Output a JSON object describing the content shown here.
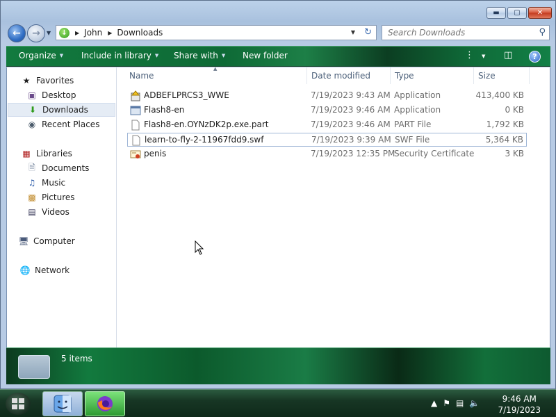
{
  "window": {
    "controls": {
      "minimize": "▬",
      "maximize": "▢",
      "close": "✕"
    }
  },
  "address": {
    "crumbs": [
      "John",
      "Downloads"
    ],
    "search_placeholder": "Search Downloads"
  },
  "toolbar": {
    "organize": "Organize",
    "include_in_library": "Include in library",
    "share_with": "Share with",
    "new_folder": "New folder",
    "help": "?"
  },
  "sidebar": {
    "favorites": {
      "label": "Favorites",
      "items": [
        {
          "label": "Desktop",
          "icon": "desktop-icon"
        },
        {
          "label": "Downloads",
          "icon": "downloads-icon",
          "selected": true
        },
        {
          "label": "Recent Places",
          "icon": "recent-places-icon"
        }
      ]
    },
    "libraries": {
      "label": "Libraries",
      "items": [
        {
          "label": "Documents",
          "icon": "documents-icon"
        },
        {
          "label": "Music",
          "icon": "music-icon"
        },
        {
          "label": "Pictures",
          "icon": "pictures-icon"
        },
        {
          "label": "Videos",
          "icon": "videos-icon"
        }
      ]
    },
    "computer": "Computer",
    "network": "Network"
  },
  "columns": {
    "name": "Name",
    "date": "Date modified",
    "type": "Type",
    "size": "Size"
  },
  "files": [
    {
      "name": "ADBEFLPRCS3_WWE",
      "date": "7/19/2023 9:43 AM",
      "type": "Application",
      "size": "413,400 KB",
      "icon": "installer-icon"
    },
    {
      "name": "Flash8-en",
      "date": "7/19/2023 9:46 AM",
      "type": "Application",
      "size": "0 KB",
      "icon": "application-icon"
    },
    {
      "name": "Flash8-en.OYNzDK2p.exe.part",
      "date": "7/19/2023 9:46 AM",
      "type": "PART File",
      "size": "1,792 KB",
      "icon": "blank-file-icon"
    },
    {
      "name": "learn-to-fly-2-11967fdd9.swf",
      "date": "7/19/2023 9:39 AM",
      "type": "SWF File",
      "size": "5,364 KB",
      "icon": "blank-file-icon",
      "focused": true
    },
    {
      "name": "penis",
      "date": "7/19/2023 12:35 PM",
      "type": "Security Certificate",
      "size": "3 KB",
      "icon": "certificate-icon"
    }
  ],
  "details": {
    "count": "5 items"
  },
  "taskbar": {
    "time": "9:46 AM",
    "date": "7/19/2023"
  },
  "colors": {
    "toolbar_green": "#127a3e",
    "selection": "#e5ecf5",
    "muted_text": "#6d6d6d"
  }
}
